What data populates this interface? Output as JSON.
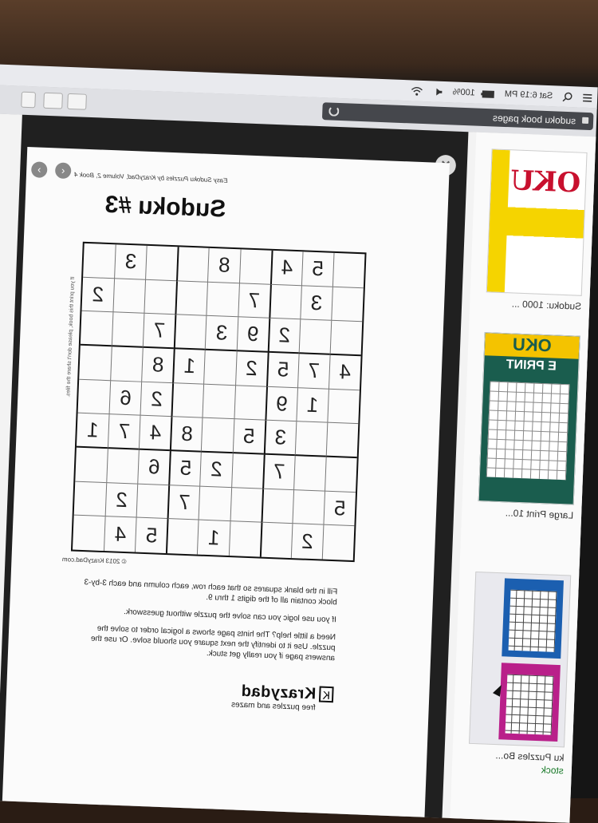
{
  "menubar": {
    "time": "Sat 6:19 PM",
    "battery": "100%",
    "icons": [
      "list-icon",
      "search-icon",
      "wifi-icon",
      "volume-icon",
      "battery-icon"
    ]
  },
  "browser": {
    "url_text": "sudoku book pages"
  },
  "results": [
    {
      "caption": "Sudoku: 1000 ...",
      "cover_big": "OKU"
    },
    {
      "caption": "Large Print 10...",
      "cover_big": "OKU",
      "cover_band": "E PRINT"
    },
    {
      "caption": "ku Puzzles Bo...",
      "sub": "stock"
    }
  ],
  "puzzle": {
    "header": "Easy Sudoku Puzzles by KrazyDad, Volume 2, Book 4",
    "title": "Sudoku #3",
    "grid": [
      [
        "",
        "5",
        "4",
        "",
        "8",
        "",
        "",
        "3",
        ""
      ],
      [
        "",
        "3",
        "",
        "7",
        "",
        "",
        "",
        "",
        "2"
      ],
      [
        "",
        "",
        "2",
        "9",
        "3",
        "",
        "7",
        "",
        ""
      ],
      [
        "4",
        "7",
        "5",
        "2",
        "",
        "1",
        "8",
        "",
        ""
      ],
      [
        "",
        "1",
        "9",
        "",
        "",
        "",
        "2",
        "6",
        ""
      ],
      [
        "",
        "",
        "3",
        "5",
        "",
        "8",
        "4",
        "7",
        "1"
      ],
      [
        "",
        "",
        "7",
        "",
        "2",
        "5",
        "6",
        "",
        ""
      ],
      [
        "5",
        "",
        "",
        "",
        "",
        "7",
        "",
        "2",
        ""
      ],
      [
        "",
        "2",
        "",
        "",
        "1",
        "",
        "5",
        "4",
        ""
      ]
    ],
    "copyright": "© 2013 KrazyDad.com",
    "side_note": "If you print this book, please don't share the files.",
    "instructions": [
      "Fill in the blank squares so that each row, each column and each 3-by-3 block contain all of the digits 1 thru 9.",
      "If you use logic you can solve the puzzle without guesswork.",
      "Need a little help? The hints page shows a logical order to solve the puzzle. Use it to identify the next square you should solve. Or use the answers page if you really get stuck."
    ],
    "logo_name": "Krazydad",
    "logo_tag": "free puzzles and mazes"
  }
}
